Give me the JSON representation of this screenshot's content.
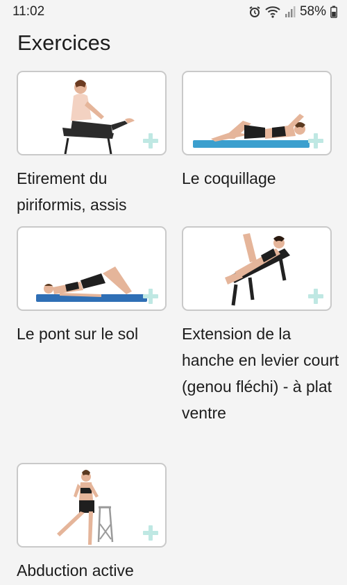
{
  "status_bar": {
    "time": "11:02",
    "battery": "58%",
    "icons": [
      "alarm-icon",
      "wifi-icon",
      "signal-icon",
      "battery-icon"
    ]
  },
  "page": {
    "title": "Exercices"
  },
  "accent_color": "#bfe8e3",
  "exercises": [
    {
      "label": "Etirement du piriformis, assis",
      "icon": "seated-stretch-illustration"
    },
    {
      "label": "Le coquillage",
      "icon": "side-lying-clamshell-illustration"
    },
    {
      "label": "Le pont sur le sol",
      "icon": "floor-bridge-illustration"
    },
    {
      "label": "Extension de la hanche en levier court (genou fléchi) - à plat ventre",
      "icon": "prone-hip-extension-illustration"
    },
    {
      "label": "Abduction active",
      "icon": "standing-abduction-illustration"
    }
  ]
}
